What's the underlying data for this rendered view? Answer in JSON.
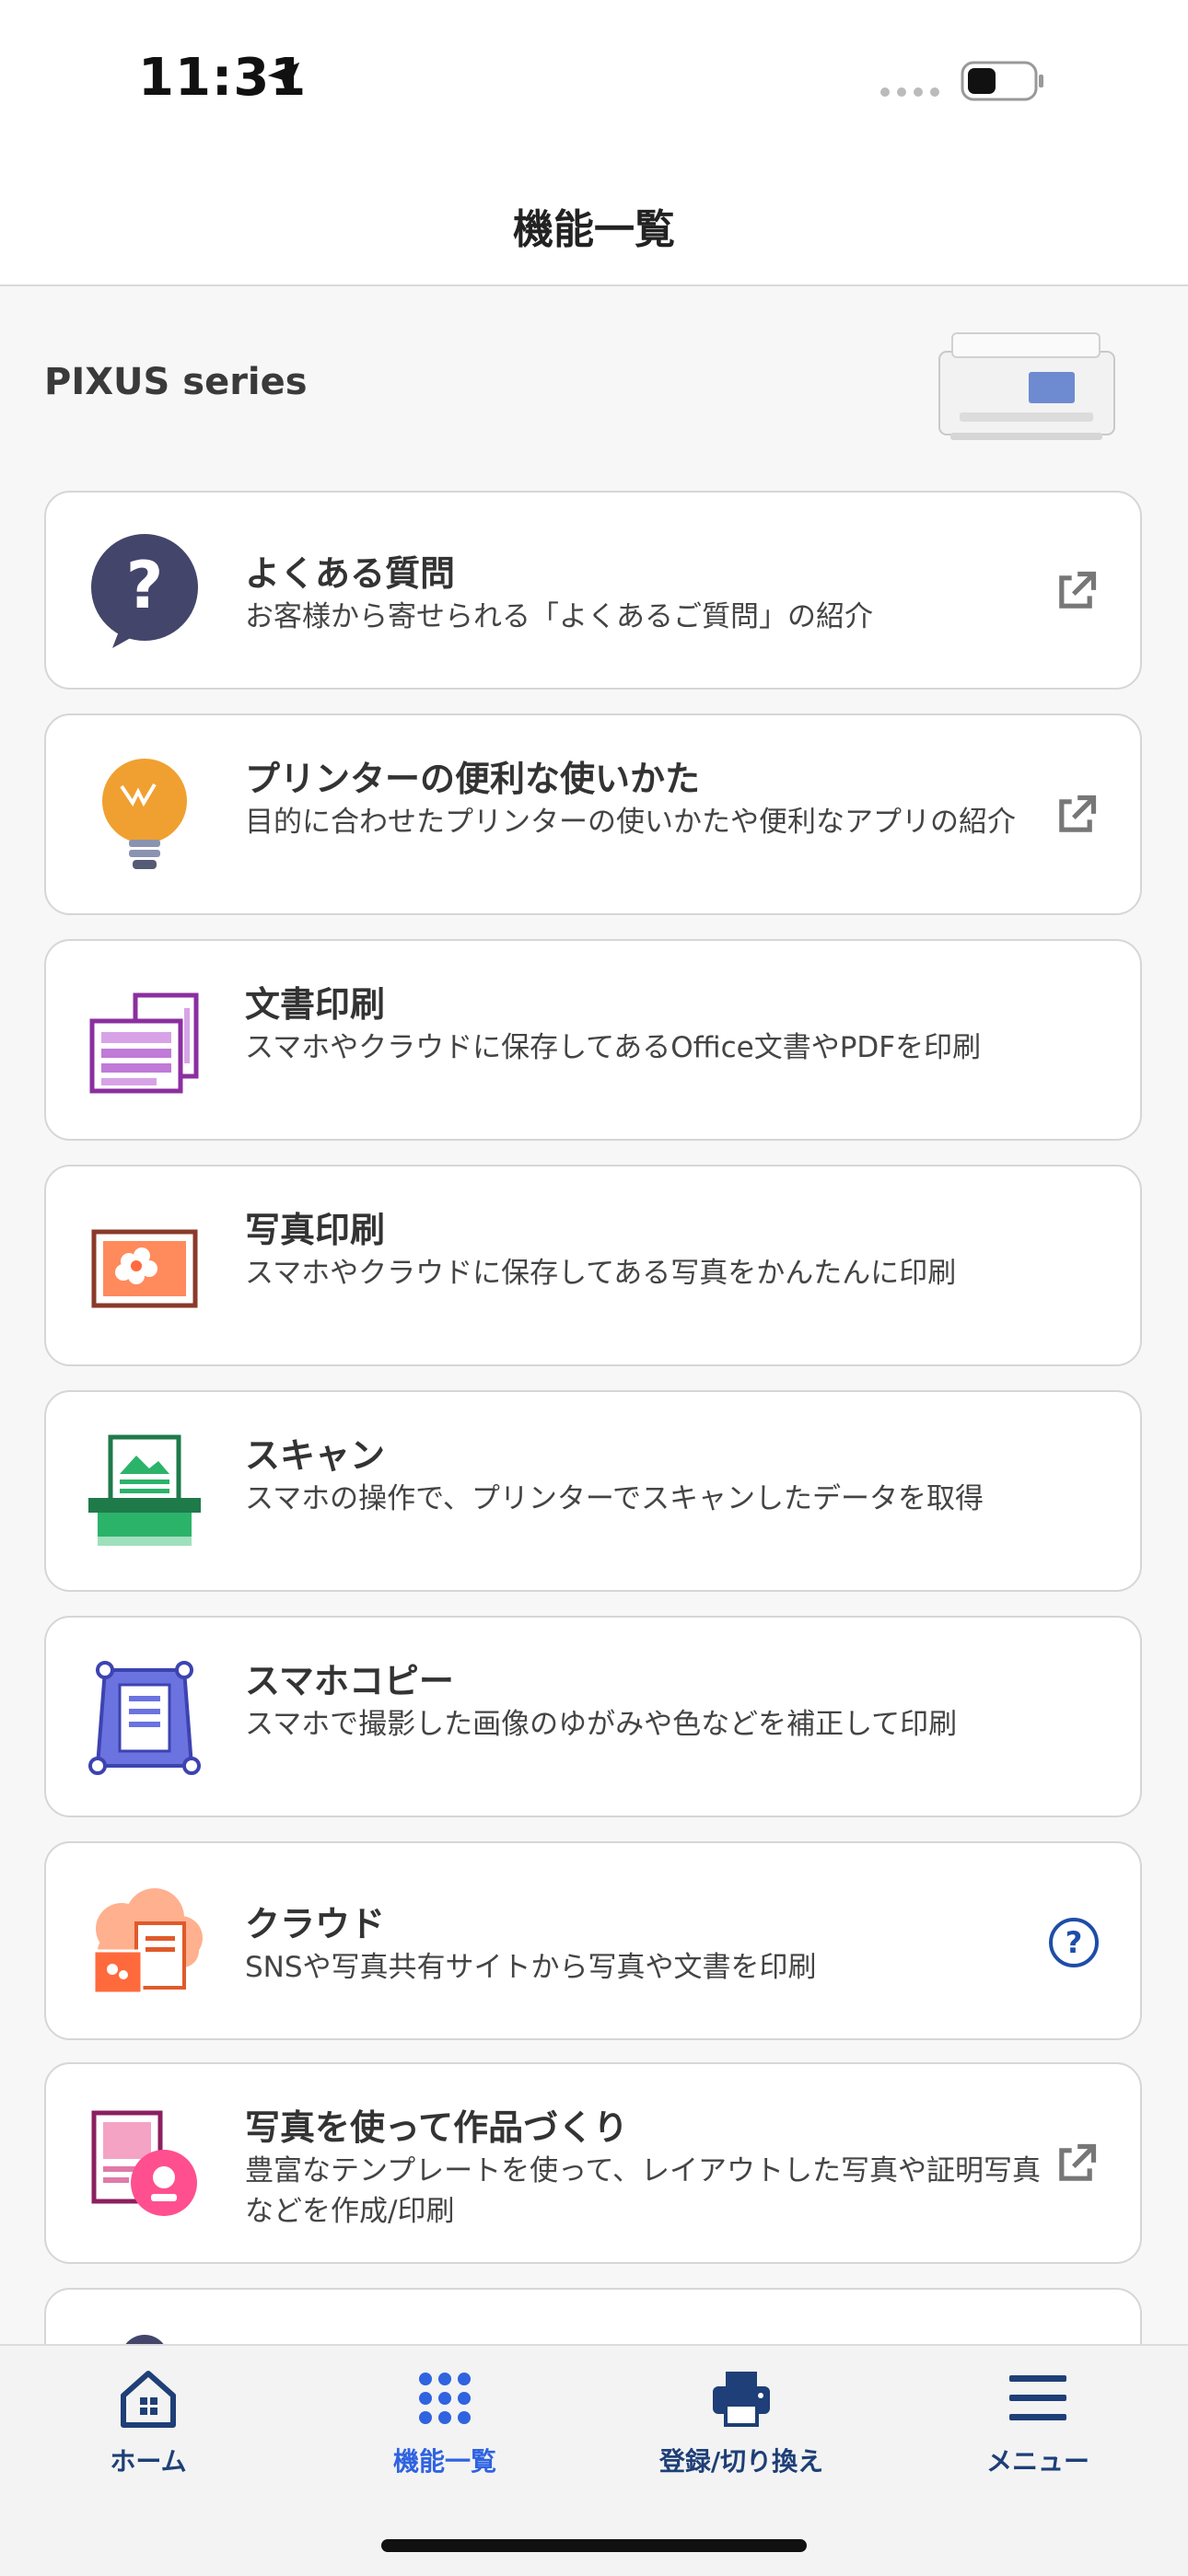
{
  "status": {
    "time": "11:31"
  },
  "nav": {
    "title": "機能一覧"
  },
  "printer": {
    "name": "PIXUS series"
  },
  "features": [
    {
      "title": "よくある質問",
      "desc": "お客様から寄せられる「よくあるご質問」の紹介",
      "icon": "faq-icon",
      "trailing": "external-link-icon"
    },
    {
      "title": "プリンターの便利な使いかた",
      "desc": "目的に合わせたプリンターの使いかたや便利なアプリの紹介",
      "icon": "lightbulb-icon",
      "trailing": "external-link-icon"
    },
    {
      "title": "文書印刷",
      "desc": "スマホやクラウドに保存してあるOffice文書やPDFを印刷",
      "icon": "document-print-icon",
      "trailing": ""
    },
    {
      "title": "写真印刷",
      "desc": "スマホやクラウドに保存してある写真をかんたんに印刷",
      "icon": "photo-print-icon",
      "trailing": ""
    },
    {
      "title": "スキャン",
      "desc": "スマホの操作で、プリンターでスキャンしたデータを取得",
      "icon": "scan-icon",
      "trailing": ""
    },
    {
      "title": "スマホコピー",
      "desc": "スマホで撮影した画像のゆがみや色などを補正して印刷",
      "icon": "smartphone-copy-icon",
      "trailing": ""
    },
    {
      "title": "クラウド",
      "desc": "SNSや写真共有サイトから写真や文書を印刷",
      "icon": "cloud-icon",
      "trailing": "help-icon"
    },
    {
      "title": "写真を使って作品づくり",
      "desc": "豊富なテンプレートを使って、レイアウトした写真や証明写真などを作成/印刷",
      "icon": "photo-creation-icon",
      "trailing": "external-link-icon"
    }
  ],
  "tabs": [
    {
      "label": "ホーム",
      "icon": "home-icon",
      "active": false
    },
    {
      "label": "機能一覧",
      "icon": "grid-icon",
      "active": true
    },
    {
      "label": "登録/切り換え",
      "icon": "printer-icon",
      "active": false
    },
    {
      "label": "メニュー",
      "icon": "hamburger-menu-icon",
      "active": false
    }
  ],
  "colors": {
    "accent": "#2f63e0",
    "navy": "#1e3f77",
    "faq": "#44456a",
    "bulb": "#f0a030",
    "doc": "#8b2fa0",
    "photo": "#ff6a3d",
    "scan": "#2bb36a",
    "copy": "#6a73e0",
    "cloud": "#ff8866",
    "create": "#e04f8a"
  }
}
